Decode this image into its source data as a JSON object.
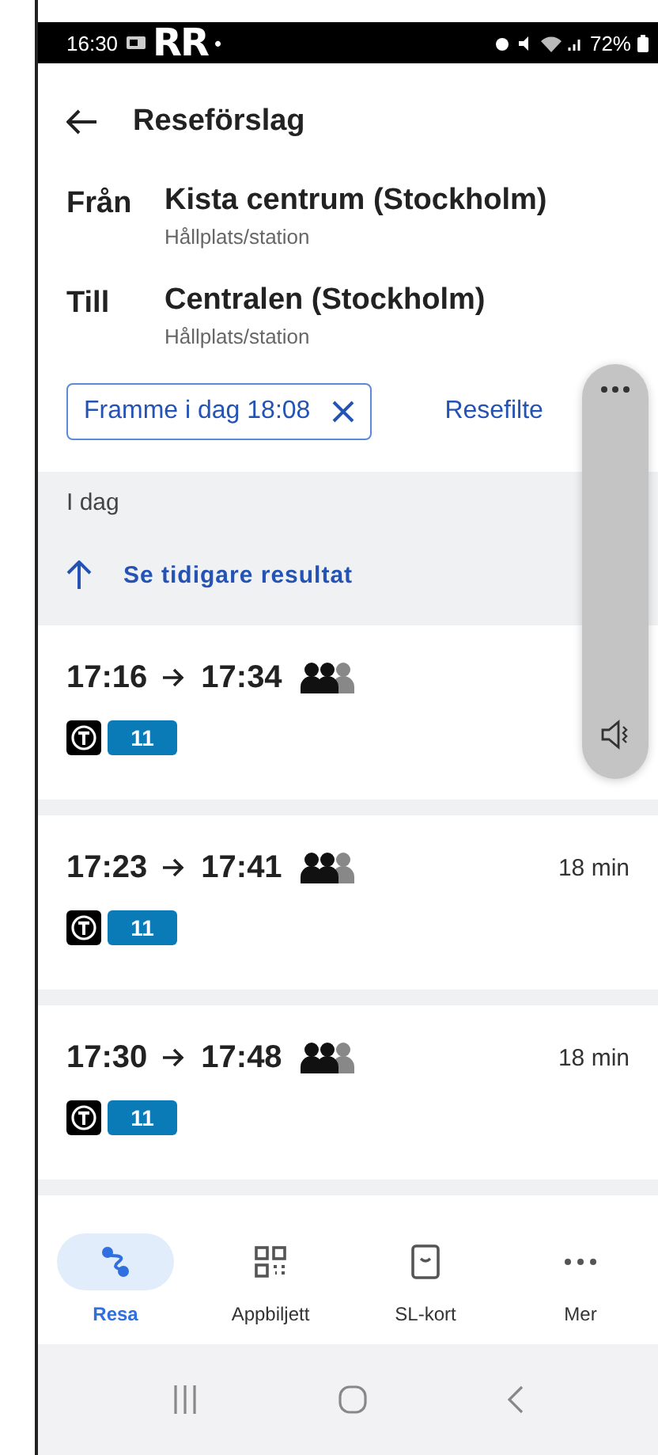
{
  "status_bar": {
    "time": "16:30",
    "logo": "RR",
    "dot": "•",
    "battery": "72%"
  },
  "header": {
    "title": "Reseförslag"
  },
  "route": [
    {
      "label": "Från",
      "name": "Kista centrum (Stockholm)",
      "type": "Hållplats/station"
    },
    {
      "label": "Till",
      "name": "Centralen (Stockholm)",
      "type": "Hållplats/station"
    }
  ],
  "filters": {
    "time_chip": "Framme i dag 18:08",
    "filter_link": "Resefilte"
  },
  "results": {
    "day": "I dag",
    "earlier_link": "Se tidigare resultat",
    "trips": [
      {
        "departure": "17:16",
        "arrival": "17:34",
        "line": "11"
      },
      {
        "departure": "17:23",
        "arrival": "17:41",
        "duration": "18 min",
        "line": "11"
      },
      {
        "departure": "17:30",
        "arrival": "17:48",
        "duration": "18 min",
        "line": "11"
      }
    ]
  },
  "bottom_nav": [
    {
      "label": "Resa",
      "selected": true
    },
    {
      "label": "Appbiljett",
      "selected": false
    },
    {
      "label": "SL-kort",
      "selected": false
    },
    {
      "label": "Mer",
      "selected": false
    }
  ]
}
